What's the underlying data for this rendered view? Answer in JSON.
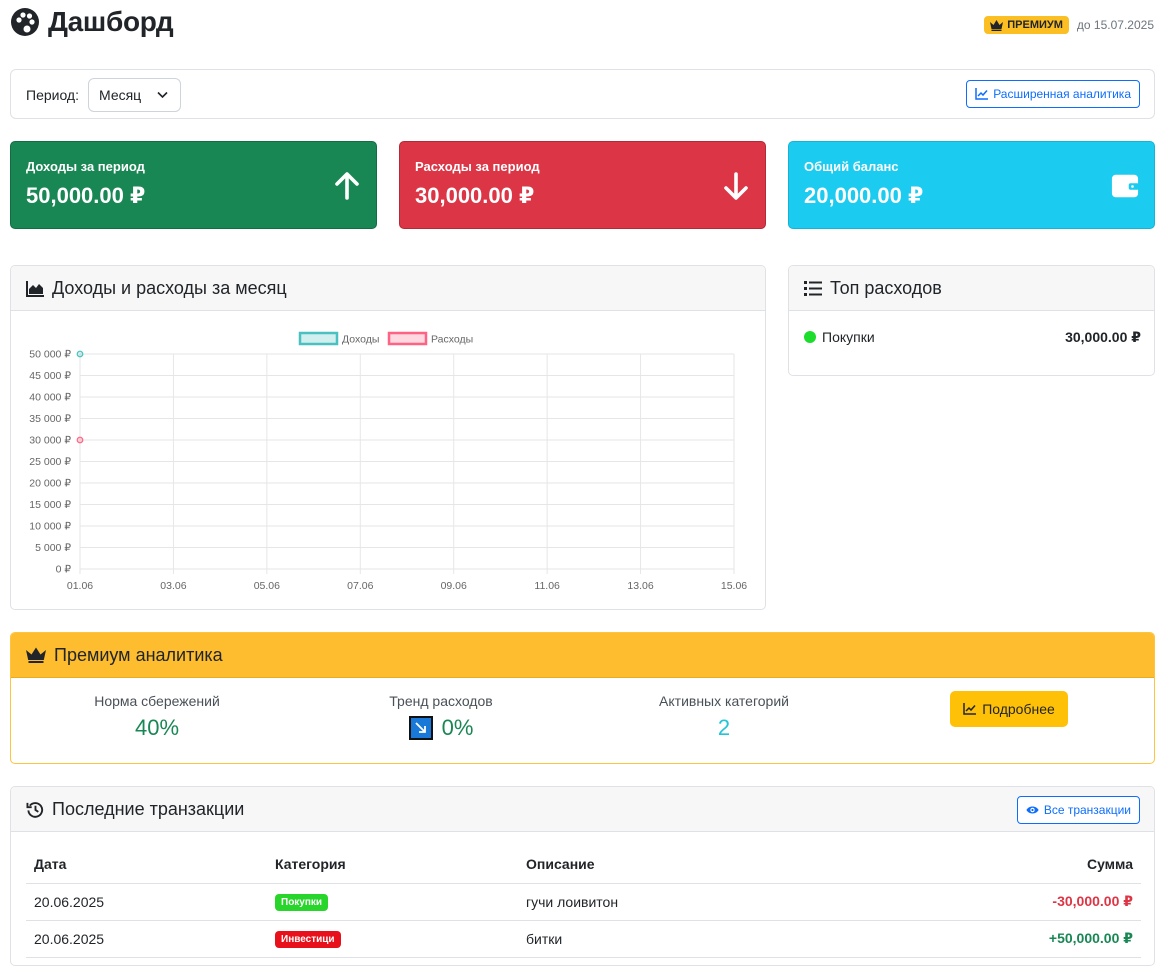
{
  "header": {
    "title": "Дашборд",
    "premium_badge": "ПРЕМИУМ",
    "premium_until": "до 15.07.2025"
  },
  "filters": {
    "period_label": "Период:",
    "period_value": "Месяц",
    "analytics_button": "Расширенная аналитика"
  },
  "stats": {
    "income": {
      "label": "Доходы за период",
      "value": "50,000.00 ₽"
    },
    "expense": {
      "label": "Расходы за период",
      "value": "30,000.00 ₽"
    },
    "balance": {
      "label": "Общий баланс",
      "value": "20,000.00 ₽"
    }
  },
  "chart_card": {
    "title": "Доходы и расходы за месяц"
  },
  "chart_data": {
    "type": "line",
    "x": [
      "01.06",
      "02.06",
      "03.06",
      "04.06",
      "05.06",
      "06.06",
      "07.06",
      "08.06",
      "09.06",
      "10.06",
      "11.06",
      "12.06",
      "13.06",
      "14.06",
      "15.06"
    ],
    "x_tick_labels": [
      "01.06",
      "03.06",
      "05.06",
      "07.06",
      "09.06",
      "11.06",
      "13.06",
      "15.06"
    ],
    "series": [
      {
        "name": "Доходы",
        "color": "#4bc0c0",
        "values": [
          50000,
          null,
          null,
          null,
          null,
          null,
          null,
          null,
          null,
          null,
          null,
          null,
          null,
          null,
          null
        ]
      },
      {
        "name": "Расходы",
        "color": "#ff6384",
        "values": [
          30000,
          null,
          null,
          null,
          null,
          null,
          null,
          null,
          null,
          null,
          null,
          null,
          null,
          null,
          null
        ]
      }
    ],
    "y_ticks": [
      "50 000 ₽",
      "45 000 ₽",
      "40 000 ₽",
      "35 000 ₽",
      "30 000 ₽",
      "25 000 ₽",
      "20 000 ₽",
      "15 000 ₽",
      "10 000 ₽",
      "5 000 ₽",
      "0 ₽"
    ],
    "ylim": [
      0,
      50000
    ],
    "grid": true,
    "legend": "top"
  },
  "top_expenses": {
    "title": "Топ расходов",
    "items": [
      {
        "name": "Покупки",
        "amount": "30,000.00 ₽",
        "color": "#1cdc2c"
      }
    ]
  },
  "premium": {
    "title": "Премиум аналитика",
    "savings_label": "Норма сбережений",
    "savings_value": "40%",
    "trend_label": "Тренд расходов",
    "trend_value": "0%",
    "categories_label": "Активных категорий",
    "categories_value": "2",
    "details_button": "Подробнее"
  },
  "transactions": {
    "title": "Последние транзакции",
    "all_button": "Все транзакции",
    "columns": [
      "Дата",
      "Категория",
      "Описание",
      "Сумма"
    ],
    "rows": [
      {
        "date": "20.06.2025",
        "category": "Покупки",
        "category_color": "#28d52a",
        "description": "гучи лоивитон",
        "amount": "-30,000.00 ₽"
      },
      {
        "date": "20.06.2025",
        "category": "Инвестици",
        "category_color": "#e8101b",
        "description": "битки",
        "amount": "+50,000.00 ₽"
      }
    ]
  }
}
